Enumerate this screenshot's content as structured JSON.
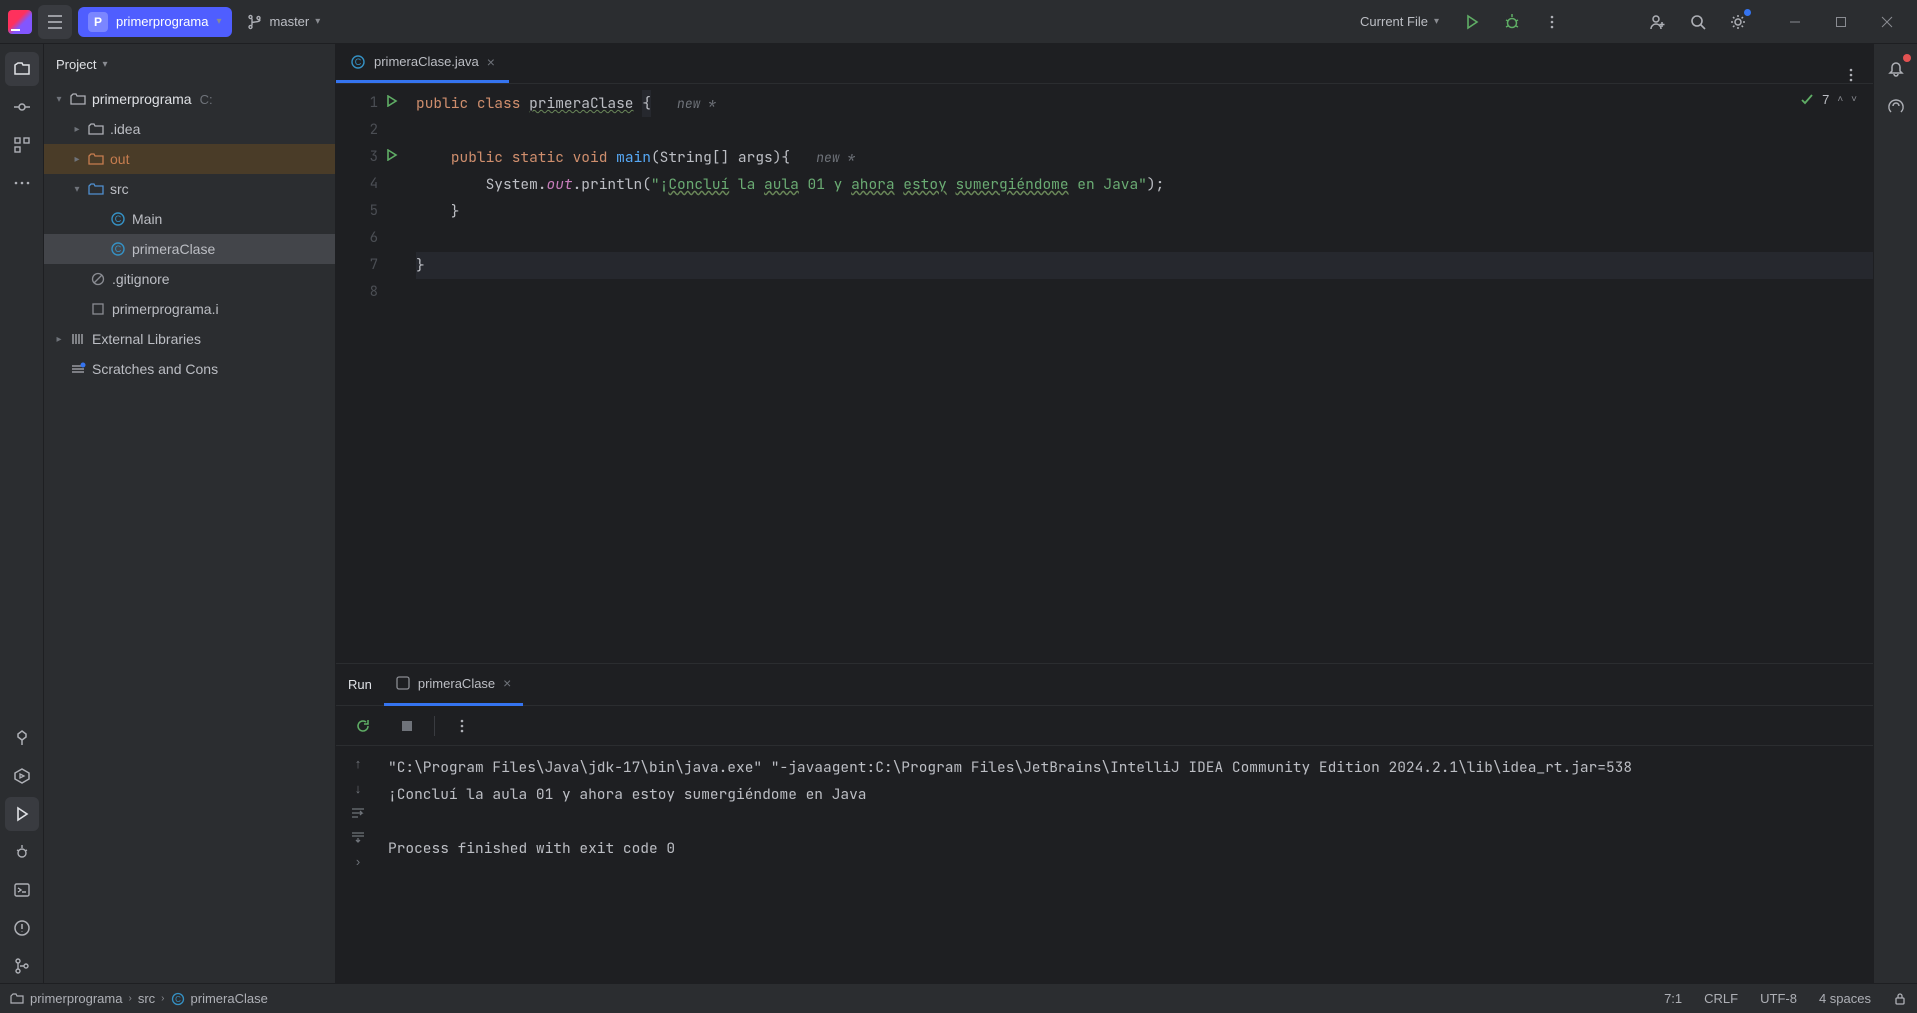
{
  "titlebar": {
    "project_name": "primerprograma",
    "branch": "master",
    "run_config": "Current File"
  },
  "project_panel": {
    "title": "Project",
    "root": "primerprograma",
    "root_extra": "C:",
    "idea": ".idea",
    "out": "out",
    "src": "src",
    "main_class": "Main",
    "primera_class": "primeraClase",
    "gitignore": ".gitignore",
    "iml": "primerprograma.i",
    "ext_libs": "External Libraries",
    "scratches": "Scratches and Cons"
  },
  "editor": {
    "tab_label": "primeraClase.java",
    "problems_count": "7",
    "code_lines": [
      "public class primeraClase {",
      "",
      "    public static void main(String[] args){",
      "        System.out.println(\"¡Concluí la aula 01 y ahora estoy sumergiéndome en Java\");",
      "    }",
      "",
      "}",
      ""
    ],
    "hint1": "new *",
    "hint3": "new *"
  },
  "run_panel": {
    "title": "Run",
    "tab": "primeraClase",
    "console_cmd": "\"C:\\Program Files\\Java\\jdk-17\\bin\\java.exe\" \"-javaagent:C:\\Program Files\\JetBrains\\IntelliJ IDEA Community Edition 2024.2.1\\lib\\idea_rt.jar=538",
    "console_out": "¡Concluí la aula 01 y ahora estoy sumergiéndome en Java",
    "console_exit": "Process finished with exit code 0"
  },
  "statusbar": {
    "crumb1": "primerprograma",
    "crumb2": "src",
    "crumb3": "primeraClase",
    "line_col": "7:1",
    "line_sep": "CRLF",
    "encoding": "UTF-8",
    "indent": "4 spaces"
  }
}
